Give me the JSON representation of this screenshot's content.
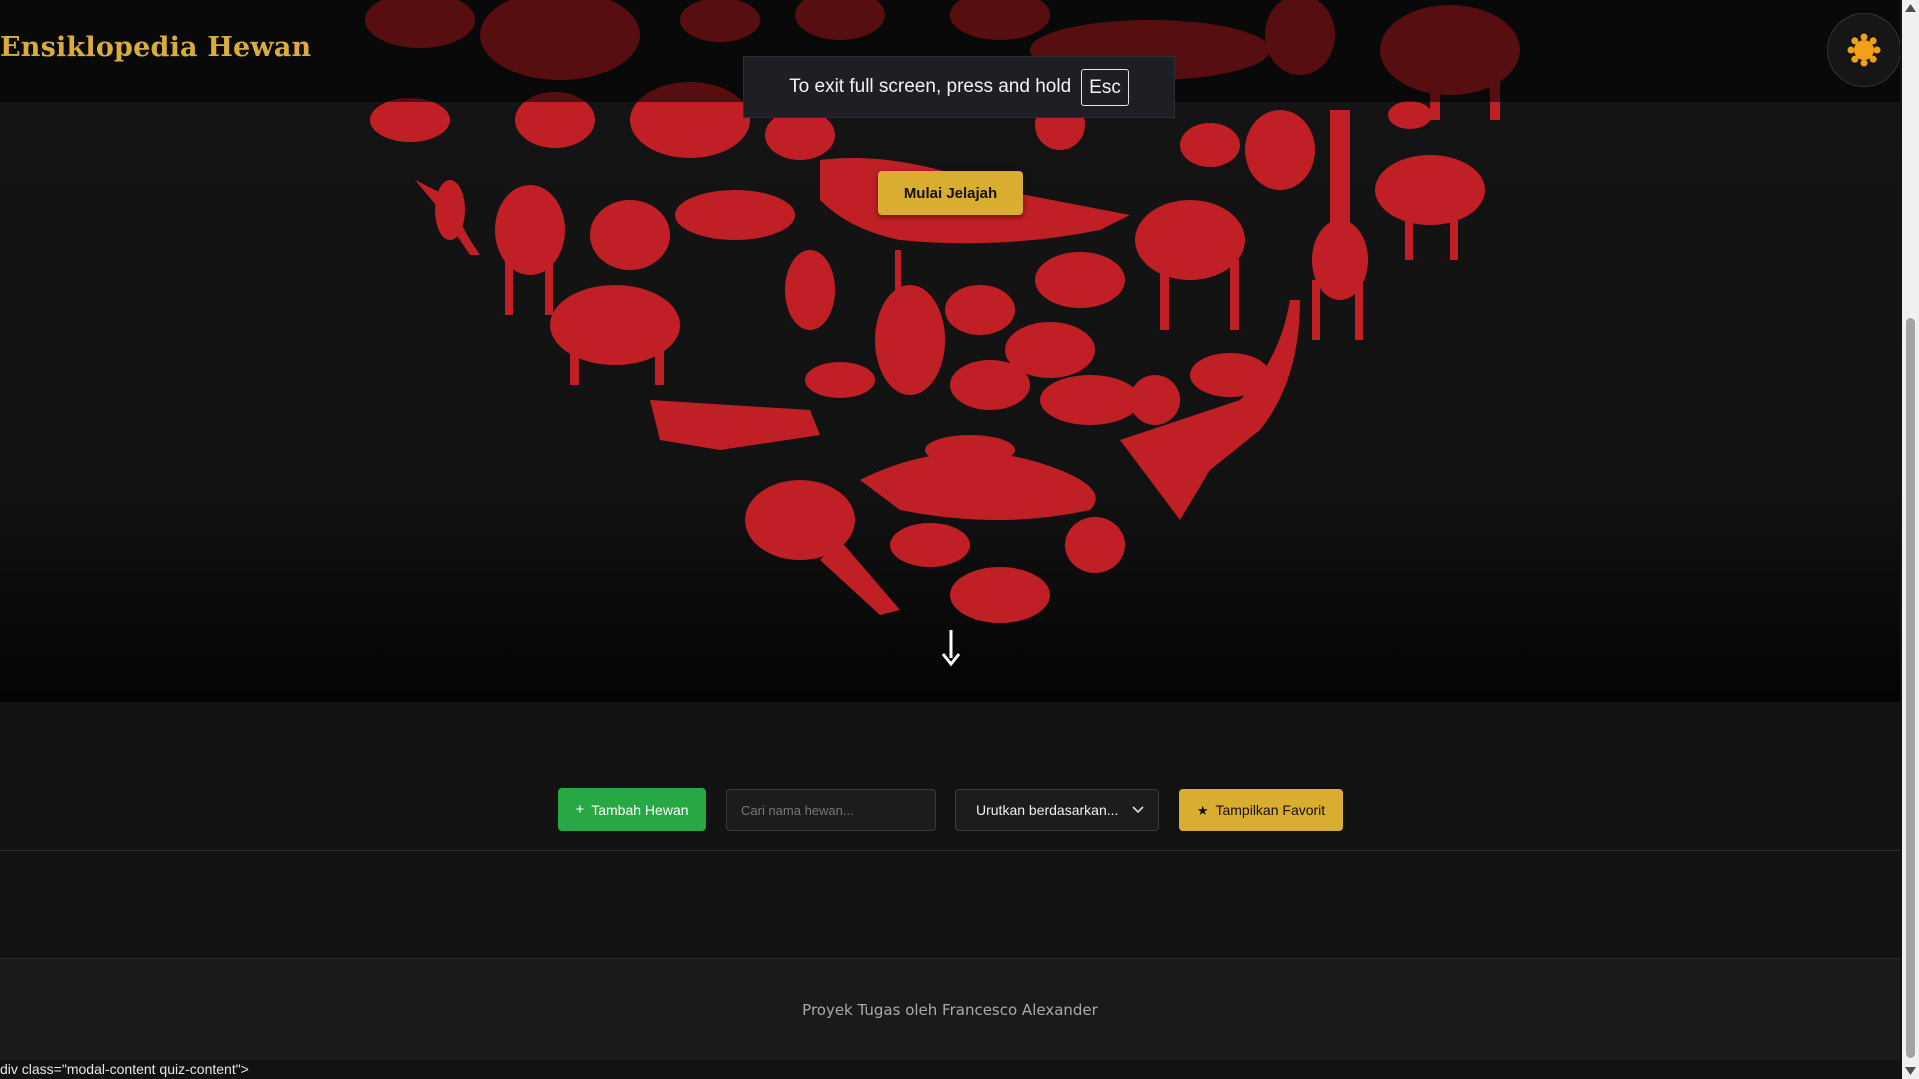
{
  "navbar": {
    "site_title": "Ensiklopedia Hewan",
    "theme_icon": "sun-icon"
  },
  "fullscreen_notice": {
    "text": "To exit full screen, press and hold",
    "key": "Esc"
  },
  "hero": {
    "start_button": "Mulai Jelajah",
    "scroll_icon": "arrow-down-icon",
    "art_color": "#c11f26"
  },
  "toolbar": {
    "add_button": "Tambah Hewan",
    "add_icon": "plus-icon",
    "search_placeholder": "Cari nama hewan...",
    "sort_label": "Urutkan berdasarkan...",
    "sort_icon": "chevron-down-icon",
    "favorite_button": "Tampilkan Favorit",
    "favorite_icon": "star-icon"
  },
  "footer": {
    "credit": "Proyek Tugas oleh Francesco Alexander"
  },
  "status_bar": {
    "text": "div class=\"modal-content quiz-content\">"
  },
  "colors": {
    "accent_gold": "#d9ad30",
    "add_green": "#28a745",
    "background": "#121212"
  }
}
